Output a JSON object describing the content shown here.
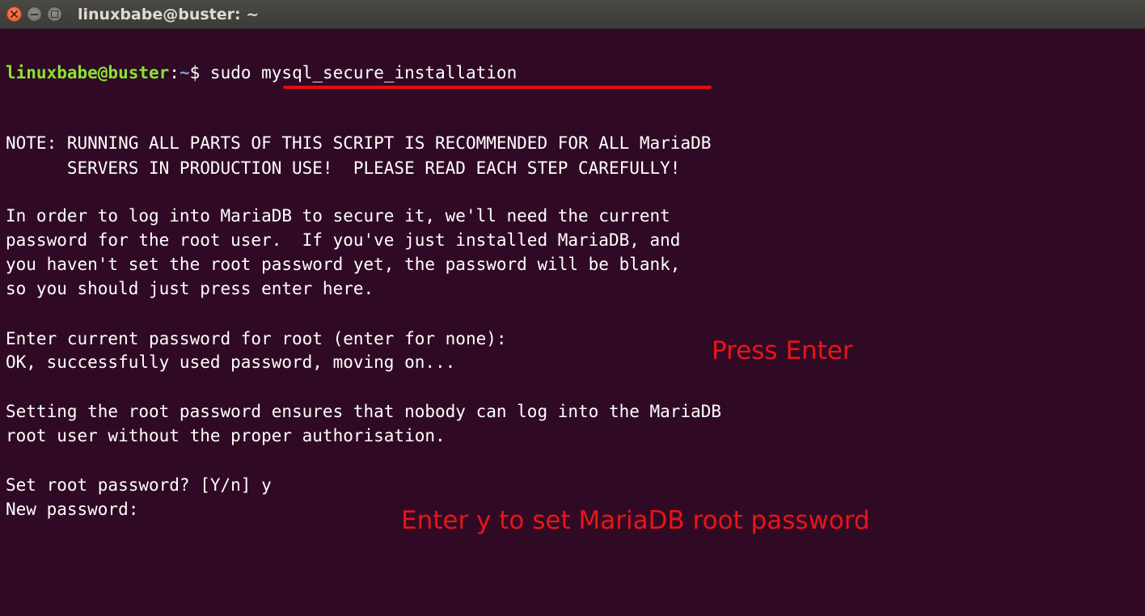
{
  "window": {
    "title": "linuxbabe@buster: ~"
  },
  "terminal": {
    "prompt": {
      "user_host": "linuxbabe@buster",
      "separator": ":",
      "path": "~",
      "symbol": "$",
      "command": "sudo mysql_secure_installation"
    },
    "lines": [
      "NOTE: RUNNING ALL PARTS OF THIS SCRIPT IS RECOMMENDED FOR ALL MariaDB",
      "      SERVERS IN PRODUCTION USE!  PLEASE READ EACH STEP CAREFULLY!",
      "In order to log into MariaDB to secure it, we'll need the current",
      "password for the root user.  If you've just installed MariaDB, and",
      "you haven't set the root password yet, the password will be blank,",
      "so you should just press enter here.",
      "Enter current password for root (enter for none): ",
      "OK, successfully used password, moving on...",
      "Setting the root password ensures that nobody can log into the MariaDB",
      "root user without the proper authorisation.",
      "Set root password? [Y/n] y",
      "New password:"
    ]
  },
  "annotations": {
    "press_enter": "Press Enter",
    "enter_y": "Enter y to set MariaDB root password"
  },
  "colors": {
    "background": "#300a24",
    "prompt_user": "#8ae234",
    "prompt_path": "#729fcf",
    "annotation": "#e8141a"
  }
}
